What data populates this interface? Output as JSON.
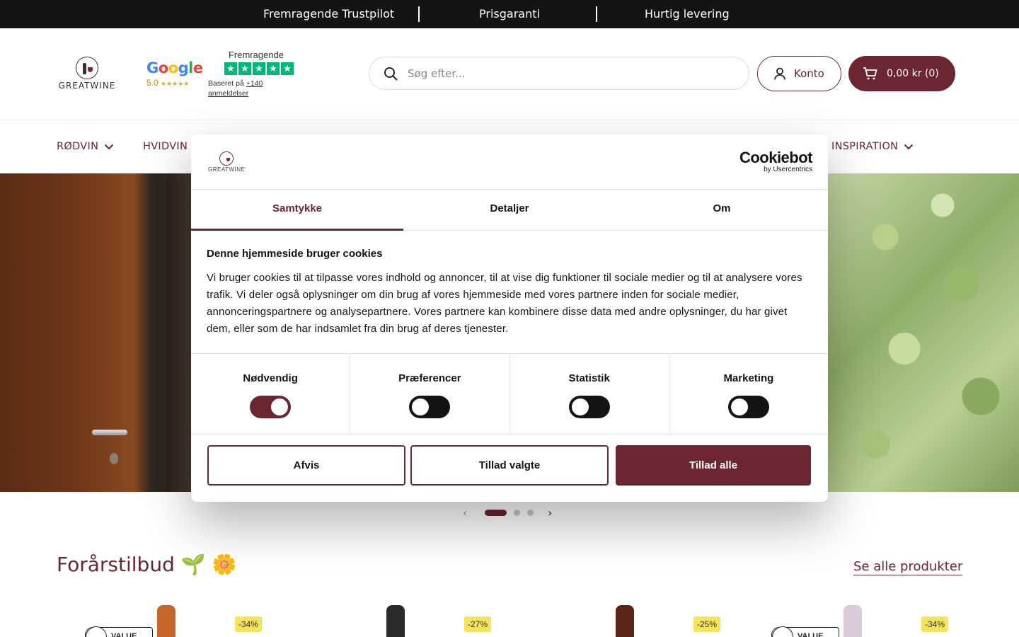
{
  "topbar": {
    "items": [
      "Fremragende Trustpilot",
      "Prisgaranti",
      "Hurtig levering"
    ]
  },
  "header": {
    "logo_text": "GREATWINE",
    "google": {
      "wordmark": "Google",
      "rating": "5.0",
      "stars": "★★★★★"
    },
    "trustpilot": {
      "label": "Fremragende",
      "based_on": "Baseret på",
      "reviews": "+140 anmeldelser"
    },
    "search": {
      "placeholder": "Søg efter..."
    },
    "account_label": "Konto",
    "cart_label": "0,00 kr (0)"
  },
  "nav": {
    "items": [
      "RØDVIN",
      "HVIDVIN",
      "INSPIRATION"
    ]
  },
  "cookie_dialog": {
    "logo_text": "GREATWINE",
    "brand": "Cookiebot",
    "brand_sub": "by Usercentrics",
    "tabs": [
      "Samtykke",
      "Detaljer",
      "Om"
    ],
    "active_tab": "Samtykke",
    "heading": "Denne hjemmeside bruger cookies",
    "body": "Vi bruger cookies til at tilpasse vores indhold og annoncer, til at vise dig funktioner til sociale medier og til at analysere vores trafik. Vi deler også oplysninger om din brug af vores hjemmeside med vores partnere inden for sociale medier, annonceringspartnere og analysepartnere. Vores partnere kan kombinere disse data med andre oplysninger, du har givet dem, eller som de har indsamlet fra din brug af deres tjenester.",
    "categories": [
      {
        "label": "Nødvendig",
        "enabled": true
      },
      {
        "label": "Præferencer",
        "enabled": false
      },
      {
        "label": "Statistik",
        "enabled": false
      },
      {
        "label": "Marketing",
        "enabled": false
      }
    ],
    "buttons": {
      "reject": "Afvis",
      "allow_selected": "Tillad valgte",
      "allow_all": "Tillad alle"
    }
  },
  "carousel": {
    "slides": 3,
    "active_slide": 1
  },
  "section": {
    "title": "Forårstilbud 🌱 🌼",
    "see_all": "Se alle produkter"
  },
  "products": [
    {
      "discount": "-34%",
      "value_badge": "VALUE",
      "bottle_color": "#c7662c"
    },
    {
      "discount": "-27%",
      "value_badge": "",
      "bottle_color": "#2a2a2a"
    },
    {
      "discount": "-25%",
      "value_badge": "",
      "bottle_color": "#5a2418"
    },
    {
      "discount": "-34%",
      "value_badge": "VALUE",
      "bottle_color": "#d9cbd8"
    }
  ],
  "colors": {
    "brand": "#6b2631",
    "topbar_bg": "#141414",
    "trustpilot_green": "#00b67a",
    "discount_badge": "#f4e35c"
  }
}
